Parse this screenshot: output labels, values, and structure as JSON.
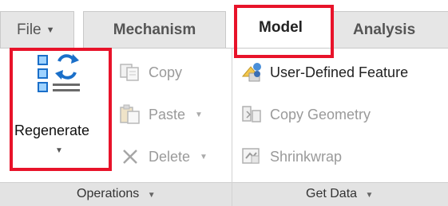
{
  "tabs": {
    "file": "File",
    "mechanism": "Mechanism",
    "model": "Model",
    "analysis": "Analysis"
  },
  "operations": {
    "regenerate": "Regenerate",
    "copy": "Copy",
    "paste": "Paste",
    "delete": "Delete",
    "group_label": "Operations"
  },
  "get_data": {
    "user_defined_feature": "User-Defined Feature",
    "copy_geometry": "Copy Geometry",
    "shrinkwrap": "Shrinkwrap",
    "group_label": "Get Data"
  },
  "colors": {
    "highlight": "#e8132a",
    "regen_blue": "#1a6fc9",
    "disabled_text": "#9a9a9a"
  },
  "icons": {
    "regenerate": "regenerate-icon",
    "copy": "copy-icon",
    "paste": "paste-icon",
    "delete": "delete-x-icon",
    "user_defined_feature": "user-defined-feature-icon",
    "copy_geometry": "copy-geometry-icon",
    "shrinkwrap": "shrinkwrap-icon"
  }
}
